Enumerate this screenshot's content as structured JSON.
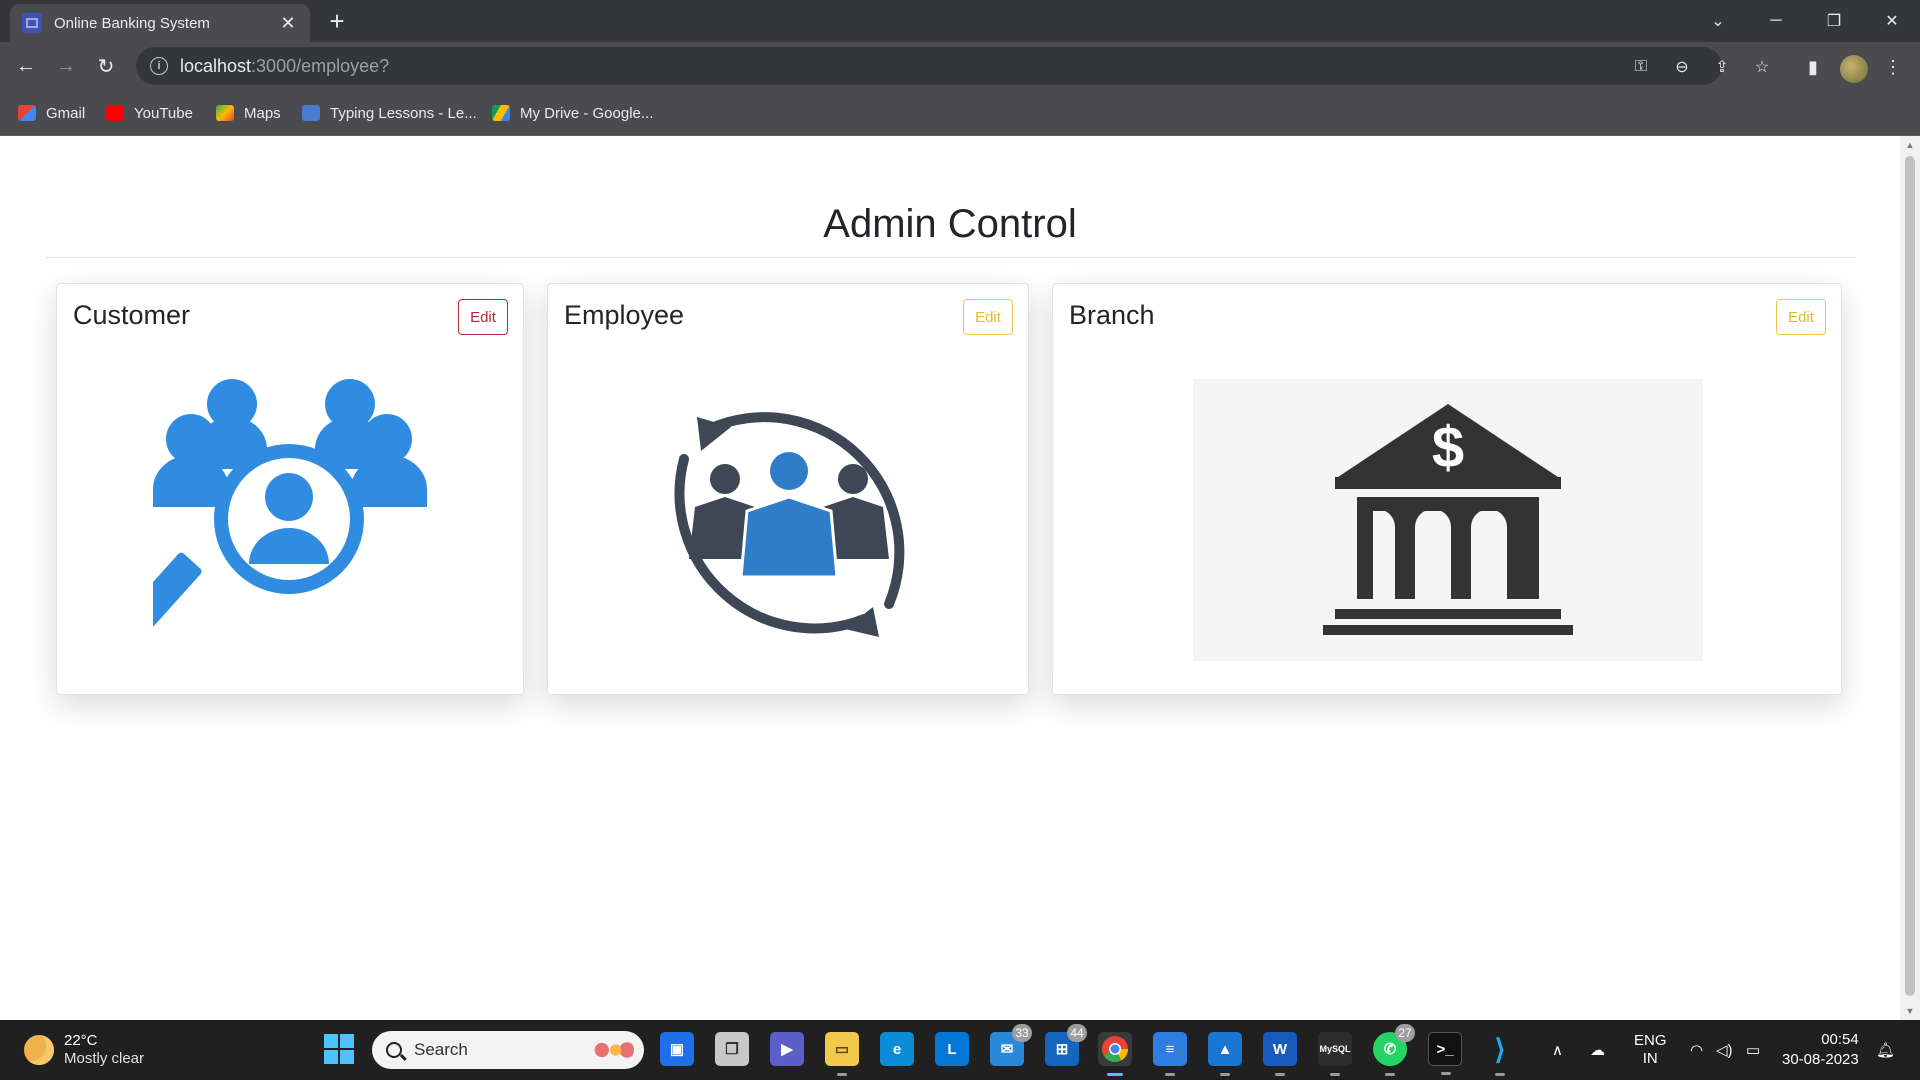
{
  "browser": {
    "tab_title": "Online Banking System",
    "url_host": "localhost",
    "url_path": ":3000/employee?",
    "bookmarks": [
      {
        "label": "Gmail",
        "icon": "gmail-icon",
        "color": "#ea4335"
      },
      {
        "label": "YouTube",
        "icon": "youtube-icon",
        "color": "#ff0000"
      },
      {
        "label": "Maps",
        "icon": "maps-icon",
        "color": "#34a853"
      },
      {
        "label": "Typing Lessons - Le...",
        "icon": "typing-icon",
        "color": "#4a7bd0"
      },
      {
        "label": "My Drive - Google...",
        "icon": "drive-icon",
        "color": "#fbbc04"
      }
    ]
  },
  "page": {
    "heading": "Admin Control",
    "cards": [
      {
        "title": "Customer",
        "edit_label": "Edit",
        "edit_color": "#b02a37",
        "icon": "customer-search-icon"
      },
      {
        "title": "Employee",
        "edit_label": "Edit",
        "edit_color": "#e2b53b",
        "icon": "employee-cycle-icon"
      },
      {
        "title": "Branch",
        "edit_label": "Edit",
        "edit_color": "#e2b53b",
        "icon": "bank-icon"
      }
    ]
  },
  "taskbar": {
    "weather_temp": "22°C",
    "weather_condition": "Mostly clear",
    "search_placeholder": "Search",
    "badges": {
      "mail": "33",
      "outlook": "44",
      "whatsapp": "27"
    },
    "language": "ENG",
    "region": "IN",
    "time": "00:54",
    "date": "30-08-2023"
  },
  "colors": {
    "icon_blue": "#2f8ce0",
    "icon_dark": "#3d4756",
    "bank_dark": "#333333"
  }
}
